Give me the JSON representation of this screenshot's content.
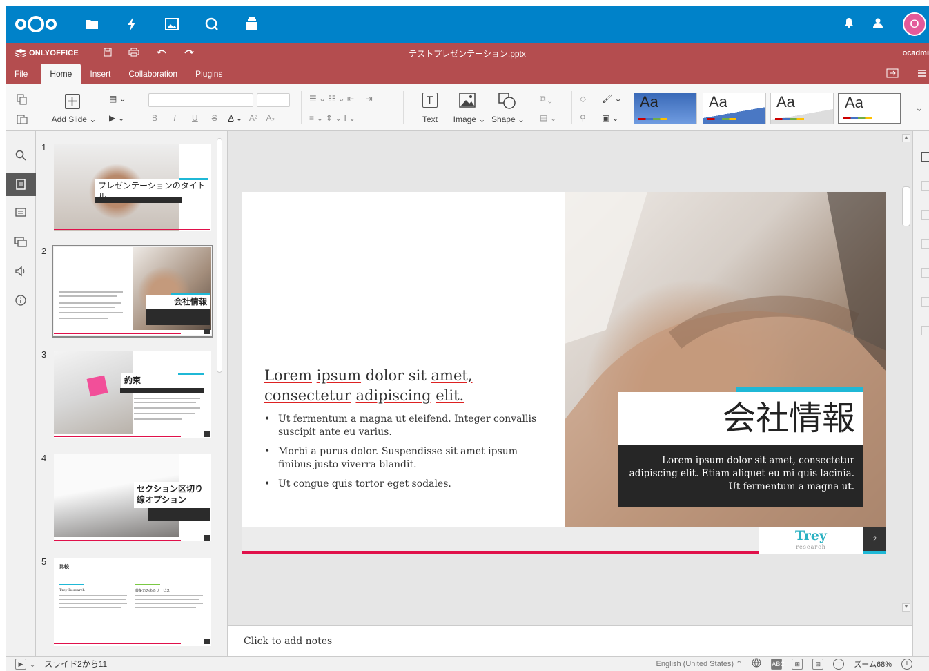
{
  "nextcloud": {
    "avatar_letter": "O",
    "apps": [
      "files-icon",
      "activity-icon",
      "photos-icon",
      "search-icon",
      "deck-icon"
    ]
  },
  "onlyoffice": {
    "brand": "ONLYOFFICE",
    "doc_title": "テストプレゼンテーション.pptx",
    "user": "ocadmi"
  },
  "tabs": [
    "File",
    "Home",
    "Insert",
    "Collaboration",
    "Plugins"
  ],
  "ribbon": {
    "add_slide": "Add Slide",
    "text": "Text",
    "image": "Image",
    "shape": "Shape",
    "themes": [
      "Aa",
      "Aa",
      "Aa",
      "Aa"
    ]
  },
  "thumbnails": {
    "numbers": [
      "1",
      "2",
      "3",
      "4",
      "5"
    ],
    "t1_title": "プレゼンテーションのタイトル",
    "t2_title": "会社情報",
    "t3_title": "約束",
    "t4_title": "セクション区切り線オプション",
    "t5_title": "比較",
    "t5_col1": "Trey Research",
    "t5_col2": "競争力のあるサービス"
  },
  "slide": {
    "heading_words": [
      "Lorem",
      "ipsum",
      "dolor",
      "sit",
      "amet,",
      "consectetur",
      "adipiscing",
      "elit."
    ],
    "bullet1": "Ut fermentum a magna ut eleifend. Integer convallis suscipit ante eu varius.",
    "bullet2": "Morbi a purus dolor. Suspendisse sit amet ipsum finibus justo viverra blandit.",
    "bullet3": "Ut congue quis tortor eget sodales.",
    "title": "会社情報",
    "body": "Lorem ipsum dolor sit amet, consectetur adipiscing elit. Etiam aliquet eu mi quis lacinia. Ut fermentum a magna ut.",
    "logo": "Trey",
    "logo_sub": "research",
    "page_number": "2"
  },
  "notes_placeholder": "Click to add notes",
  "status": {
    "slide_counter": "スライド2から11",
    "language": "English (United States)",
    "zoom": "ズーム68%"
  },
  "colors": {
    "nextcloud_blue": "#0082c9",
    "onlyoffice_red": "#b44d4f",
    "accent_pink": "#e0104a",
    "accent_cyan": "#1fb8d6"
  }
}
